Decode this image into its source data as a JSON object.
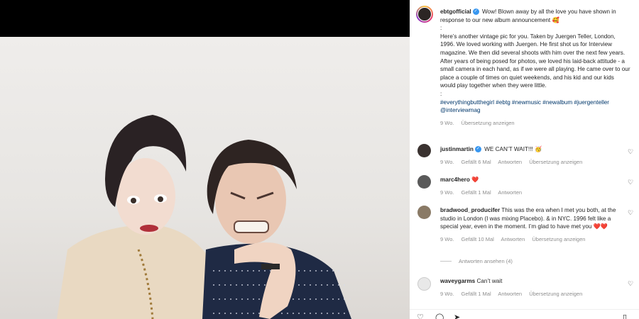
{
  "post": {
    "username": "ebtgofficial",
    "caption_intro": "Wow! Blown away by all the love you have shown in response to our new album announcement 🥰",
    "dot1": ":",
    "caption_body": "Here’s another vintage pic for you. Taken by Juergen Teller, London, 1996. We loved working with Juergen. He first shot us for Interview magazine. We then did several shoots with him over the next few years. After years of being posed for photos, we loved his laid-back attitude - a small camera in each hand, as if we were all playing. He came over to our place a couple of times on quiet weekends, and his kid and our kids would play together when they were little.",
    "dot2": ":",
    "hashtags": "#everythingbutthegirl #ebtg #newmusic #newalbum #juergenteller @interviewmag",
    "age": "9 Wo.",
    "translate": "Übersetzung anzeigen"
  },
  "comments": [
    {
      "username": "justinmartin",
      "verified": true,
      "text": "WE CAN’T WAIT!!! 🥳",
      "age": "9 Wo.",
      "likes": "Gefällt 6 Mal",
      "reply": "Antworten",
      "translate": "Übersetzung anzeigen",
      "avatar_color": "#3a3230"
    },
    {
      "username": "marc4hero",
      "verified": false,
      "text": "❤️",
      "age": "9 Wo.",
      "likes": "Gefällt 1 Mal",
      "reply": "Antworten",
      "translate": "",
      "avatar_color": "#5a5a5a"
    },
    {
      "username": "bradwood_producifer",
      "verified": false,
      "text": "This was the era when I met you both, at the studio in London (I was mixing Placebo). & in NYC. 1996 felt like a special year, even in the moment. I’m glad to have met you ❤️❤️",
      "age": "9 Wo.",
      "likes": "Gefällt 10 Mal",
      "reply": "Antworten",
      "translate": "Übersetzung anzeigen",
      "avatar_color": "#8a7a66"
    },
    {
      "username": "waveygarms",
      "verified": false,
      "text": "Can’t wait",
      "age": "9 Wo.",
      "likes": "Gefällt 1 Mal",
      "reply": "Antworten",
      "translate": "Übersetzung anzeigen",
      "avatar_color": "#d8d8d8"
    }
  ],
  "view_replies": "Antworten ansehen (4)",
  "icons": {
    "like": "heart-icon",
    "comment": "comment-icon",
    "share": "share-icon",
    "save": "bookmark-icon"
  },
  "colors": {
    "link": "#00376b",
    "muted": "#8e8e8e",
    "verified": "#3897f0",
    "heart": "#ed4956"
  }
}
